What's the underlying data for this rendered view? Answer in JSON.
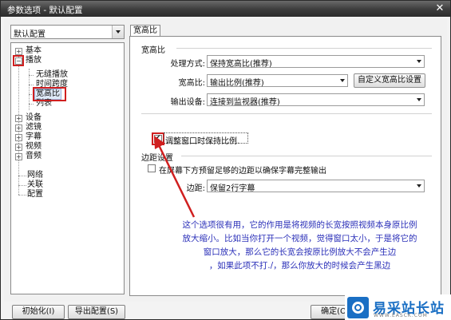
{
  "window": {
    "title": "参数选项 - 默认配置",
    "close_glyph": "✕"
  },
  "profile_select": {
    "value": "默认配置"
  },
  "tree": {
    "basic": "基本",
    "playback": "播放",
    "seamless": "无缝播放",
    "timespan": "时间跨度",
    "aspect": "宽高比",
    "list": "列表",
    "device": "设备",
    "filter": "滤镜",
    "subtitle": "字幕",
    "video": "视频",
    "audio": "音频",
    "network": "网络",
    "associate": "关联",
    "config": "配置",
    "expand_glyph": "+",
    "collapse_glyph": "−"
  },
  "tab": {
    "label": "宽高比"
  },
  "aspect_group": {
    "title": "宽高比",
    "process_label": "处理方式:",
    "process_value": "保持宽高比(推荐)",
    "ratio_label": "宽高比:",
    "ratio_value": "输出比例(推荐)",
    "custom_button": "自定义宽高比设置",
    "device_label": "输出设备:",
    "device_value": "连接到监视器(推荐)"
  },
  "keep_ratio_check": {
    "label": "调整窗口时保持比例.",
    "checked": true
  },
  "margin_group": {
    "title": "边距设置",
    "reserve_label": "在屏幕下方预留足够的边距以确保字幕完整输出",
    "reserve_checked": false,
    "margin_label": "边距:",
    "margin_value": "保留2行字幕"
  },
  "annotation": {
    "line1": "这个选项很有用，它的作用是将视频的长宽按照视频本身原比例",
    "line2": "放大缩小。比如当你打开一个视频，觉得窗口太小，于是将它的",
    "line3": "窗口放大，那么它的长宽会按原比例放大不会产生边",
    "line4": "，如果此项不打./，那么你放大的时候会产生黑边"
  },
  "bottom": {
    "init_button": "初始化(I)",
    "export_button": "导出配置(S)",
    "ok_button": "确定(O)"
  },
  "watermark": {
    "text": "易采站长站",
    "sub": "WWW.EASCK.COM"
  },
  "colors": {
    "annotation_text": "#2a2fb8",
    "highlight_red": "#d01f1f",
    "watermark_blue": "#1a6fc4"
  }
}
